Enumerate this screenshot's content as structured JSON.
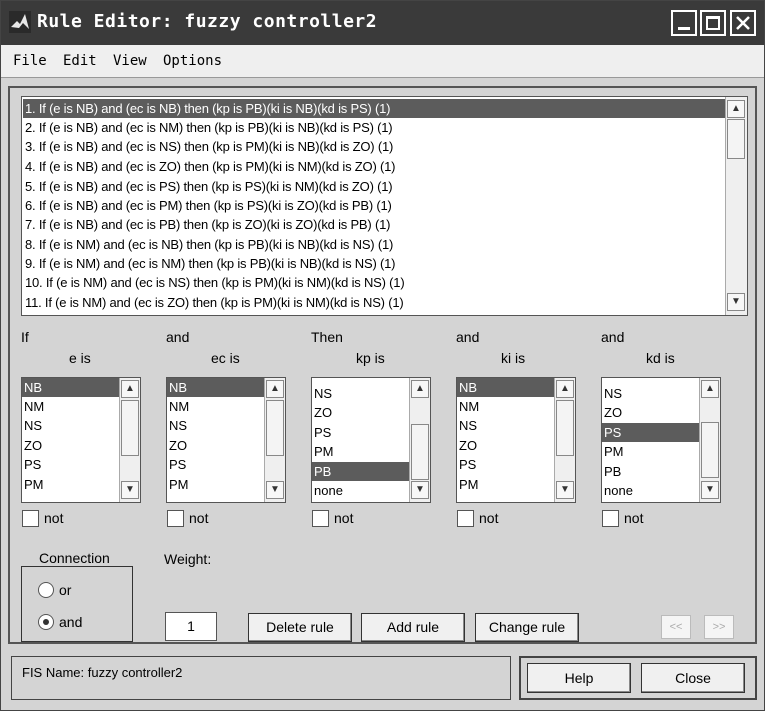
{
  "window": {
    "title": "Rule Editor: fuzzy controller2"
  },
  "menu": [
    "File",
    "Edit",
    "View",
    "Options"
  ],
  "rules": [
    "1. If (e is NB) and (ec is NB) then (kp is PB)(ki is NB)(kd is PS) (1)",
    "2. If (e is NB) and (ec is NM) then (kp is PB)(ki is NB)(kd is PS) (1)",
    "3. If (e is NB) and (ec is NS) then (kp is PM)(ki is NB)(kd is ZO) (1)",
    "4. If (e is NB) and (ec is ZO) then (kp is PM)(ki is NM)(kd is ZO) (1)",
    "5. If (e is NB) and (ec is PS) then (kp is PS)(ki is NM)(kd is ZO) (1)",
    "6. If (e is NB) and (ec is PM) then (kp is PS)(ki is ZO)(kd is PB) (1)",
    "7. If (e is NB) and (ec is PB) then (kp is ZO)(ki is ZO)(kd is PB) (1)",
    "8. If (e is NM) and (ec is NB) then (kp is PB)(ki is NB)(kd is NS) (1)",
    "9. If (e is NM) and (ec is NM) then (kp is PB)(ki is NB)(kd is NS) (1)",
    "10. If (e is NM) and (ec is NS) then (kp is PM)(ki is NM)(kd is NS) (1)",
    "11. If (e is NM) and (ec is ZO) then (kp is PM)(ki is NM)(kd is NS) (1)"
  ],
  "panels": [
    {
      "conj": "If",
      "var": "e is",
      "items": [
        "NB",
        "NM",
        "NS",
        "ZO",
        "PS",
        "PM"
      ],
      "selected": "NB",
      "not": "not"
    },
    {
      "conj": "and",
      "var": "ec is",
      "items": [
        "NB",
        "NM",
        "NS",
        "ZO",
        "PS",
        "PM"
      ],
      "selected": "NB",
      "not": "not"
    },
    {
      "conj": "Then",
      "var": "kp is",
      "items": [
        "NS",
        "ZO",
        "PS",
        "PM",
        "PB",
        "none"
      ],
      "selected": "PB",
      "not": "not"
    },
    {
      "conj": "and",
      "var": "ki is",
      "items": [
        "NB",
        "NM",
        "NS",
        "ZO",
        "PS",
        "PM"
      ],
      "selected": "NB",
      "not": "not"
    },
    {
      "conj": "and",
      "var": "kd is",
      "items": [
        "NS",
        "ZO",
        "PS",
        "PM",
        "PB",
        "none"
      ],
      "selected": "PS",
      "not": "not"
    }
  ],
  "connection": {
    "title": "Connection",
    "or": "or",
    "and": "and",
    "selected": "and"
  },
  "weight": {
    "label": "Weight:",
    "value": "1"
  },
  "buttons": {
    "delete": "Delete rule",
    "add": "Add rule",
    "change": "Change rule",
    "prev": "<<",
    "next": ">>",
    "help": "Help",
    "close": "Close"
  },
  "status": "FIS Name: fuzzy controller2"
}
